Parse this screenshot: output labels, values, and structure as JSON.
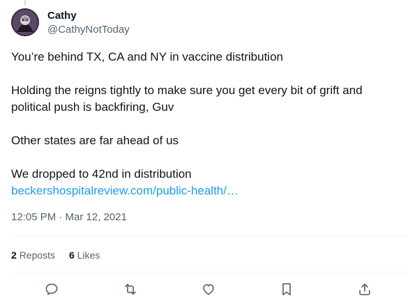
{
  "author": {
    "display_name": "Cathy",
    "handle": "@CathyNotToday"
  },
  "tweet": {
    "line1": "You’re behind TX, CA and NY in vaccine distribution",
    "line2": "Holding the reigns tightly to make sure you get every bit of grift and political push is backfiring, Guv",
    "line3": "Other states are far ahead of us",
    "line4": "We dropped to 42nd in distribution",
    "link": "beckershospitalreview.com/public-health/…"
  },
  "timestamp": "12:05 PM · Mar 12, 2021",
  "stats": {
    "reposts_count": "2",
    "reposts_label": "Reposts",
    "likes_count": "6",
    "likes_label": "Likes"
  },
  "icons": {
    "reply": "reply-icon",
    "repost": "repost-icon",
    "like": "heart-icon",
    "bookmark": "bookmark-icon",
    "share": "share-icon"
  },
  "colors": {
    "link": "#1d9bf0",
    "secondary_text": "#536471",
    "primary_text": "#0f1419"
  }
}
